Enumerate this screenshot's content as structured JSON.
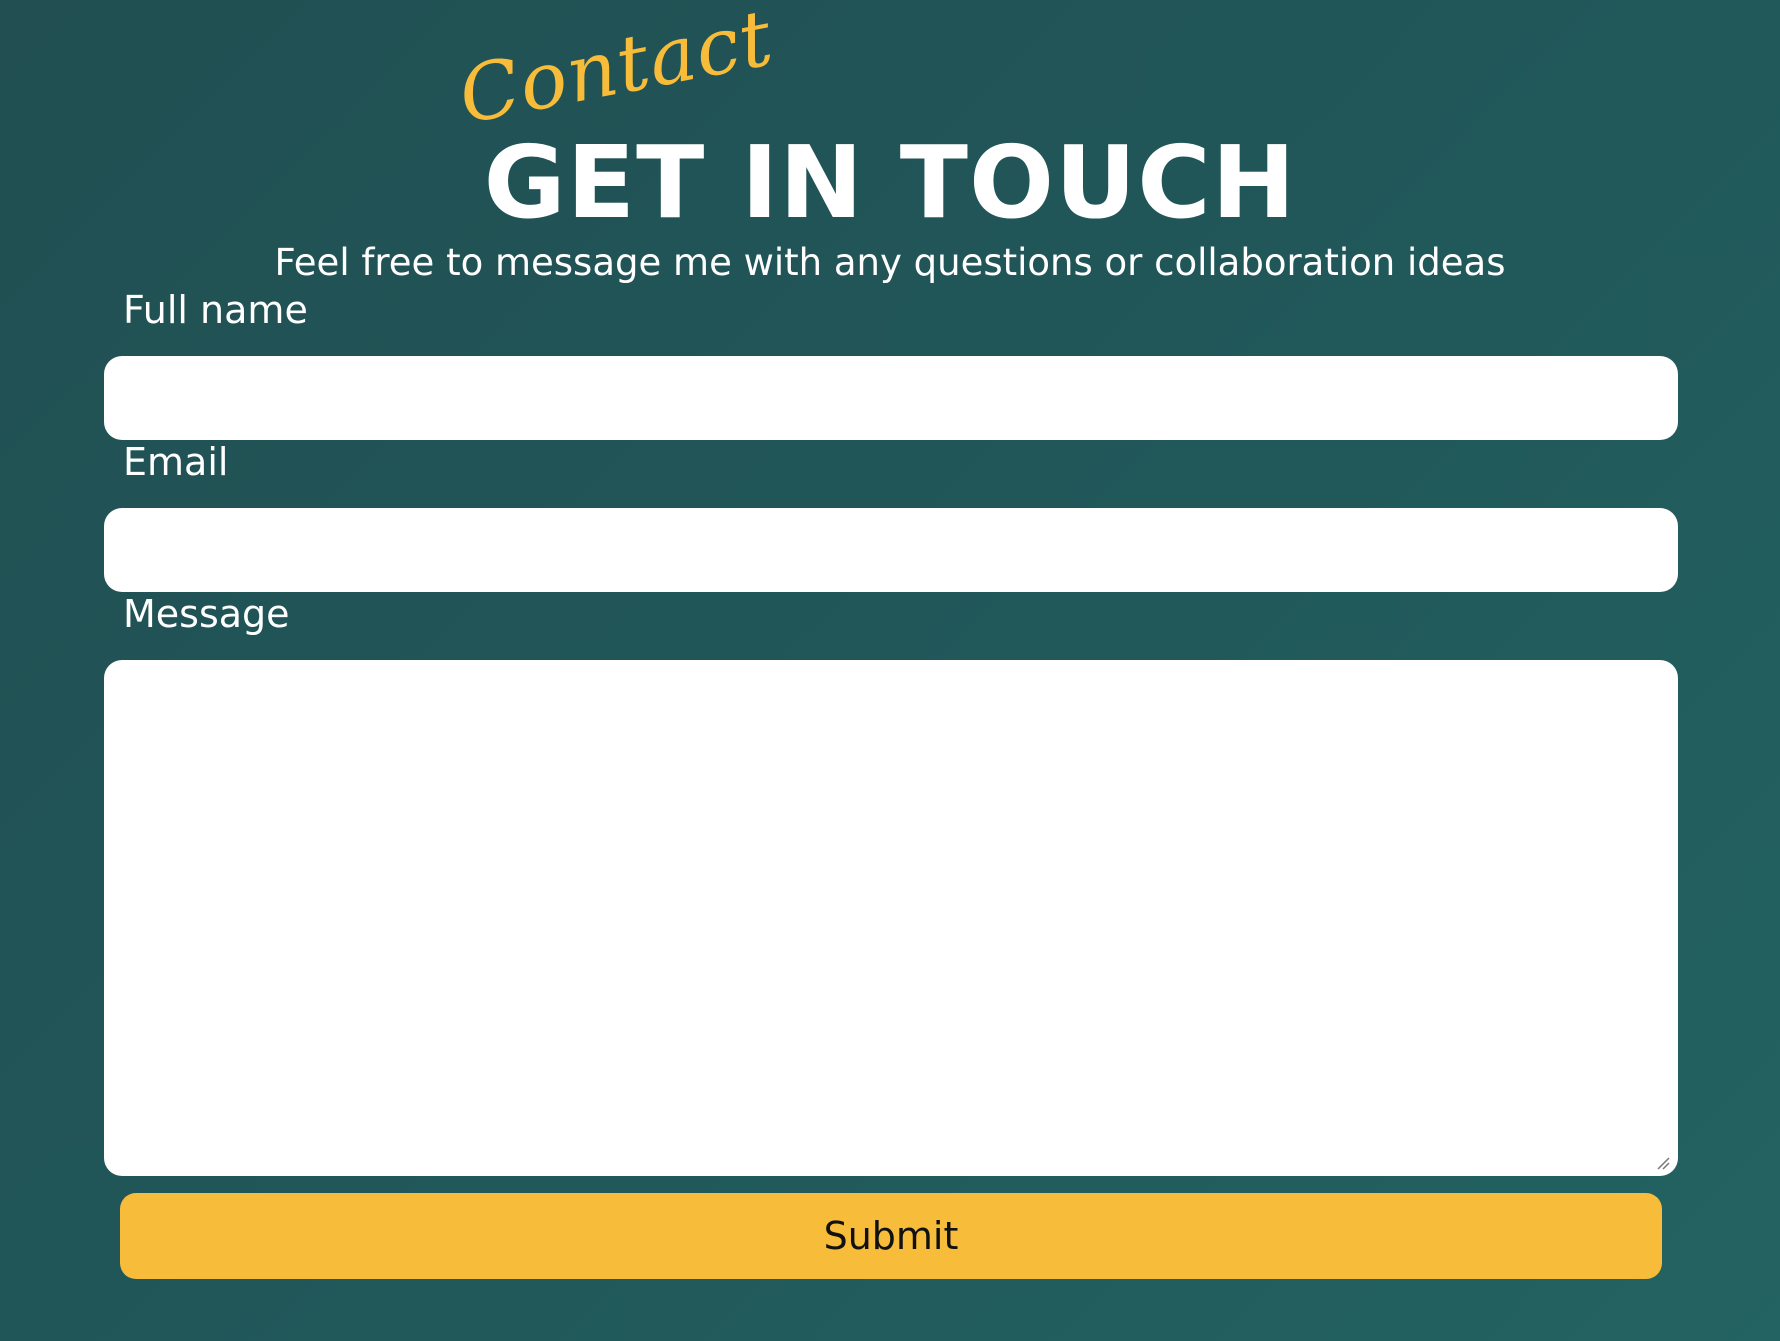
{
  "header": {
    "script_word": "Contact",
    "title": "GET IN TOUCH",
    "subtitle": "Feel free to message me with any questions or collaboration ideas"
  },
  "form": {
    "full_name": {
      "label": "Full name",
      "value": "",
      "placeholder": ""
    },
    "email": {
      "label": "Email",
      "value": "",
      "placeholder": ""
    },
    "message": {
      "label": "Message",
      "value": "",
      "placeholder": ""
    },
    "submit_label": "Submit"
  },
  "colors": {
    "background": "#21585a",
    "accent": "#f6bc3a",
    "text": "#ffffff",
    "button_text": "#111111",
    "input_background": "#ffffff"
  },
  "icons": {
    "resize_grip": "resize-grip-icon"
  }
}
